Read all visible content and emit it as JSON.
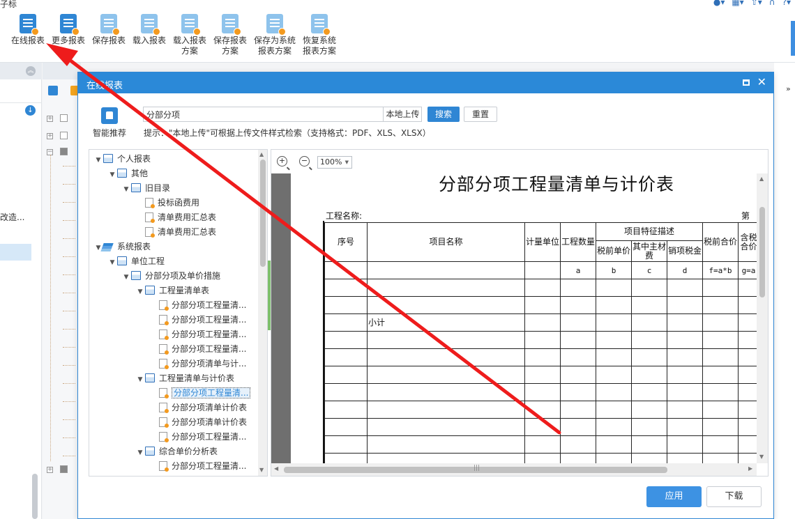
{
  "app": {
    "title": "子标"
  },
  "top_icons": [
    "globe-icon",
    "grid-icon",
    "upload-icon",
    "headset-icon",
    "help-icon"
  ],
  "toolbar": {
    "items": [
      {
        "label": "在线报表",
        "icon": "online-report-icon"
      },
      {
        "label": "更多报表",
        "icon": "more-reports-icon"
      },
      {
        "label": "保存报表",
        "icon": "save-report-icon"
      },
      {
        "label": "载入报表",
        "icon": "load-report-icon"
      },
      {
        "label": "载入报表\n方案",
        "icon": "load-scheme-icon"
      },
      {
        "label": "保存报表\n方案",
        "icon": "save-scheme-icon"
      },
      {
        "label": "保存为系统\n报表方案",
        "icon": "save-system-scheme-icon"
      },
      {
        "label": "恢复系统\n报表方案",
        "icon": "restore-system-scheme-icon"
      }
    ]
  },
  "left_panel": {
    "truncated_text": "改造..."
  },
  "dialog": {
    "title": "在线报表",
    "recommend_label": "智能推荐",
    "search": {
      "value": "分部分项",
      "upload_label": "本地上传"
    },
    "search_button": "搜索",
    "reset_button": "重置",
    "hint": "提示：\"本地上传\"可根据上传文件样式检索（支持格式：PDF、XLS、XLSX）",
    "apply_button": "应用",
    "download_button": "下载"
  },
  "tree": [
    {
      "label": "个人报表",
      "level": 0,
      "type": "folder",
      "expanded": true
    },
    {
      "label": "其他",
      "level": 1,
      "type": "folder",
      "expanded": true
    },
    {
      "label": "旧目录",
      "level": 2,
      "type": "folder",
      "expanded": true
    },
    {
      "label": "投标函费用",
      "level": 3,
      "type": "doc"
    },
    {
      "label": "清单费用汇总表",
      "level": 3,
      "type": "doc"
    },
    {
      "label": "清单费用汇总表",
      "level": 3,
      "type": "doc"
    },
    {
      "label": "系统报表",
      "level": 0,
      "type": "stack",
      "expanded": true
    },
    {
      "label": "单位工程",
      "level": 1,
      "type": "folder",
      "expanded": true
    },
    {
      "label": "分部分项及单价措施",
      "level": 2,
      "type": "folder",
      "expanded": true
    },
    {
      "label": "工程量清单表",
      "level": 3,
      "type": "folder",
      "expanded": true
    },
    {
      "label": "分部分项工程量清...",
      "level": 4,
      "type": "doc"
    },
    {
      "label": "分部分项工程量清...",
      "level": 4,
      "type": "doc"
    },
    {
      "label": "分部分项工程量清...",
      "level": 4,
      "type": "doc"
    },
    {
      "label": "分部分项工程量清...",
      "level": 4,
      "type": "doc"
    },
    {
      "label": "分部分项清单与计...",
      "level": 4,
      "type": "doc"
    },
    {
      "label": "工程量清单与计价表",
      "level": 3,
      "type": "folder",
      "expanded": true
    },
    {
      "label": "分部分项工程量清...",
      "level": 4,
      "type": "doc",
      "selected": true
    },
    {
      "label": "分部分项清单计价表",
      "level": 4,
      "type": "doc"
    },
    {
      "label": "分部分项清单计价表",
      "level": 4,
      "type": "doc"
    },
    {
      "label": "分部分项工程量清...",
      "level": 4,
      "type": "doc"
    },
    {
      "label": "综合单价分析表",
      "level": 3,
      "type": "folder",
      "expanded": true
    },
    {
      "label": "分部分项工程量清...",
      "level": 4,
      "type": "doc"
    }
  ],
  "preview": {
    "zoom": "100%",
    "doc_title": "分部分项工程量清单与计价表",
    "project_name_label": "工程名称:",
    "page_label": "第",
    "headers": {
      "seq": "序号",
      "name": "项目名称",
      "unit": "计量单位",
      "qty": "工程数量",
      "feature_group": "项目特征描述",
      "pretax_unit": "税前单价",
      "material": "其中主材费",
      "output_tax": "销项税金",
      "pretax_total": "税前合价",
      "taxed_total": "含税合价"
    },
    "formula_row": [
      "a",
      "b",
      "c",
      "d",
      "f=a*b",
      "g=a"
    ],
    "subtotal_label": "小计"
  },
  "colors": {
    "accent": "#2f86d4",
    "dialog_title": "#2b89d8",
    "annotation_arrow": "#ee1c1c"
  }
}
